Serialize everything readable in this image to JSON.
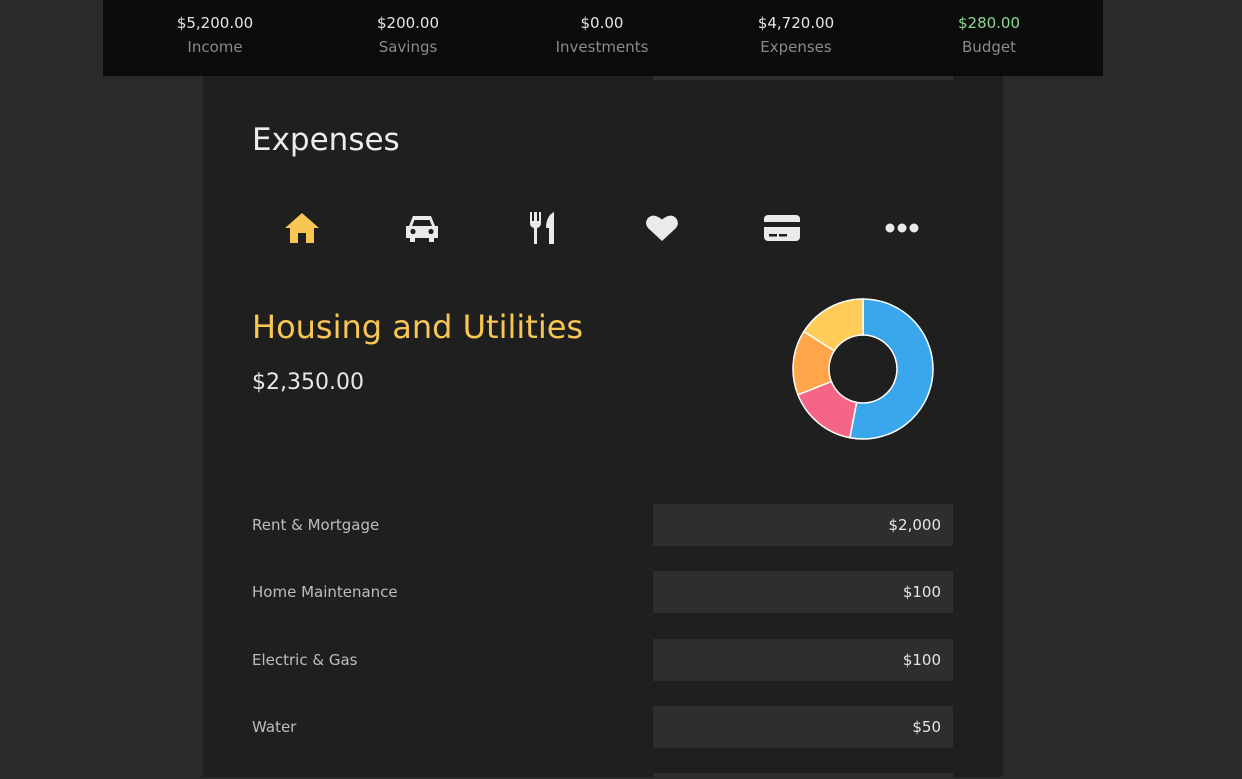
{
  "summary": {
    "items": [
      {
        "value": "$5,200.00",
        "label": "Income"
      },
      {
        "value": "$200.00",
        "label": "Savings"
      },
      {
        "value": "$0.00",
        "label": "Investments"
      },
      {
        "value": "$4,720.00",
        "label": "Expenses"
      },
      {
        "value": "$280.00",
        "label": "Budget"
      }
    ],
    "budget_color": "#8fd88f"
  },
  "page": {
    "title": "Expenses"
  },
  "categories": [
    {
      "icon": "home-icon",
      "active": true
    },
    {
      "icon": "car-icon",
      "active": false
    },
    {
      "icon": "utensils-icon",
      "active": false
    },
    {
      "icon": "heart-icon",
      "active": false
    },
    {
      "icon": "credit-card-icon",
      "active": false
    },
    {
      "icon": "more-icon",
      "active": false
    }
  ],
  "section": {
    "title": "Housing and Utilities",
    "total": "$2,350.00",
    "accent": "#f7c653"
  },
  "donut_chart": {
    "type": "pie",
    "values": [
      0.53,
      0.16,
      0.15,
      0.16
    ],
    "colors": [
      "#3aa6ec",
      "#f56586",
      "#ffa54a",
      "#ffcd57"
    ]
  },
  "fields": [
    {
      "label": "Rent & Mortgage",
      "value": "$2,000"
    },
    {
      "label": "Home Maintenance",
      "value": "$100"
    },
    {
      "label": "Electric & Gas",
      "value": "$100"
    },
    {
      "label": "Water",
      "value": "$50"
    }
  ]
}
